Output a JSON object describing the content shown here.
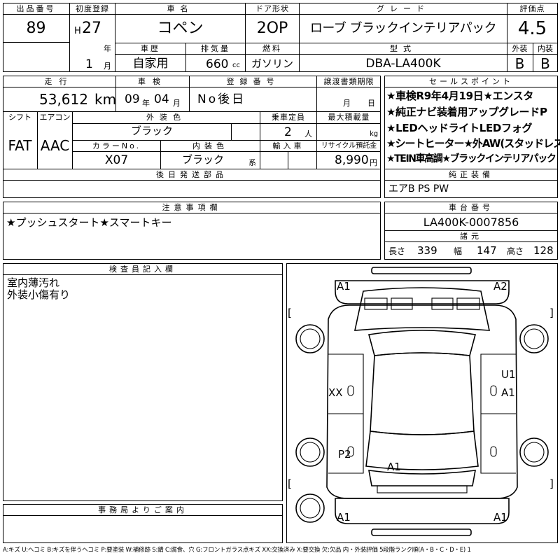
{
  "header": {
    "lot_label": "出品番号",
    "lot_value": "89",
    "first_reg_label": "初度登録",
    "era": "H",
    "year": "27",
    "year_unit": "年",
    "month": "1",
    "month_unit": "月",
    "car_name_label": "車名",
    "car_name": "コペン",
    "door_label": "ドア形状",
    "door": "2OP",
    "grade_label": "グレード",
    "grade": "ローブ ブラックインテリアパック",
    "score_label": "評価点",
    "score": "4.5",
    "history_label": "車歴",
    "history": "自家用",
    "displacement_label": "排気量",
    "displacement": "660",
    "cc_unit": "cc",
    "fuel_label": "燃料",
    "fuel": "ガソリン",
    "model_label": "型式",
    "model": "DBA-LA400K",
    "ext_label": "外装",
    "ext": "B",
    "int_label": "内装",
    "int": "B"
  },
  "row2": {
    "mileage_label": "走行",
    "mileage": "53,612",
    "km_unit": "km",
    "inspection_label": "車検",
    "insp_year": "09",
    "insp_year_unit": "年",
    "insp_month": "04",
    "insp_month_unit": "月",
    "plate_label": "登録番号",
    "plate": "No後日",
    "transfer_label": "譲渡書類期限",
    "transfer_month": "月",
    "transfer_day": "日",
    "shift_label": "シフト",
    "shift": "FAT",
    "ac_label": "エアコン",
    "ac": "AAC",
    "ext_color_label": "外装色",
    "ext_color": "ブラック",
    "capacity_label": "乗車定員",
    "capacity": "2",
    "capacity_unit": "人",
    "load_label": "最大積載量",
    "load_unit": "kg",
    "color_no_label": "カラーNo.",
    "color_no": "X07",
    "int_color_label": "内装色",
    "int_color": "ブラック",
    "int_color_unit": "系",
    "import_label": "輸入車",
    "recycle_label": "リサイクル預託金",
    "recycle": "8,990",
    "yen_unit": "円",
    "later_parts_label": "後日発送部品"
  },
  "selling_points": {
    "label": "セールスポイント",
    "lines": [
      "★車検R9年4月19日★エンスタ",
      "★純正ナビ装着用アップグレードP",
      "★LEDヘッドライトLEDフォグ",
      "★シートヒーター★外AW(スタッドレス)",
      "★TEIN車高調★ブラックインテリアパック"
    ]
  },
  "equipment": {
    "label": "純正装備",
    "value": "エアB PS PW"
  },
  "notes": {
    "label": "注意事項欄",
    "value": "★プッシュスタート★スマートキー"
  },
  "chassis": {
    "label": "車台番号",
    "value": "LA400K-0007856",
    "specs_label": "諸元",
    "length_label": "長さ",
    "length": "339",
    "width_label": "幅",
    "width": "147",
    "height_label": "高さ",
    "height": "128"
  },
  "inspector": {
    "label": "検査員記入欄",
    "lines": [
      "室内薄汚れ",
      "外装小傷有り"
    ]
  },
  "office": {
    "label": "事務局よりご案内"
  },
  "diagram": {
    "marks": [
      "A1",
      "A2",
      "XX",
      "U1",
      "A1",
      "P2",
      "A1",
      "A1",
      "A1"
    ],
    "bracket_open": "[",
    "bracket_close": "]"
  },
  "legend": "A:キズ U:ヘコミ B:キズを伴うヘコミ P:要塗装 W:補修跡 S:錆 C:腐食、穴 G:フロントガラス点キズ XX:交換済み X:要交換 欠:欠品 内・外装評価 5段階ランク順(A・B・C・D・E) 1"
}
